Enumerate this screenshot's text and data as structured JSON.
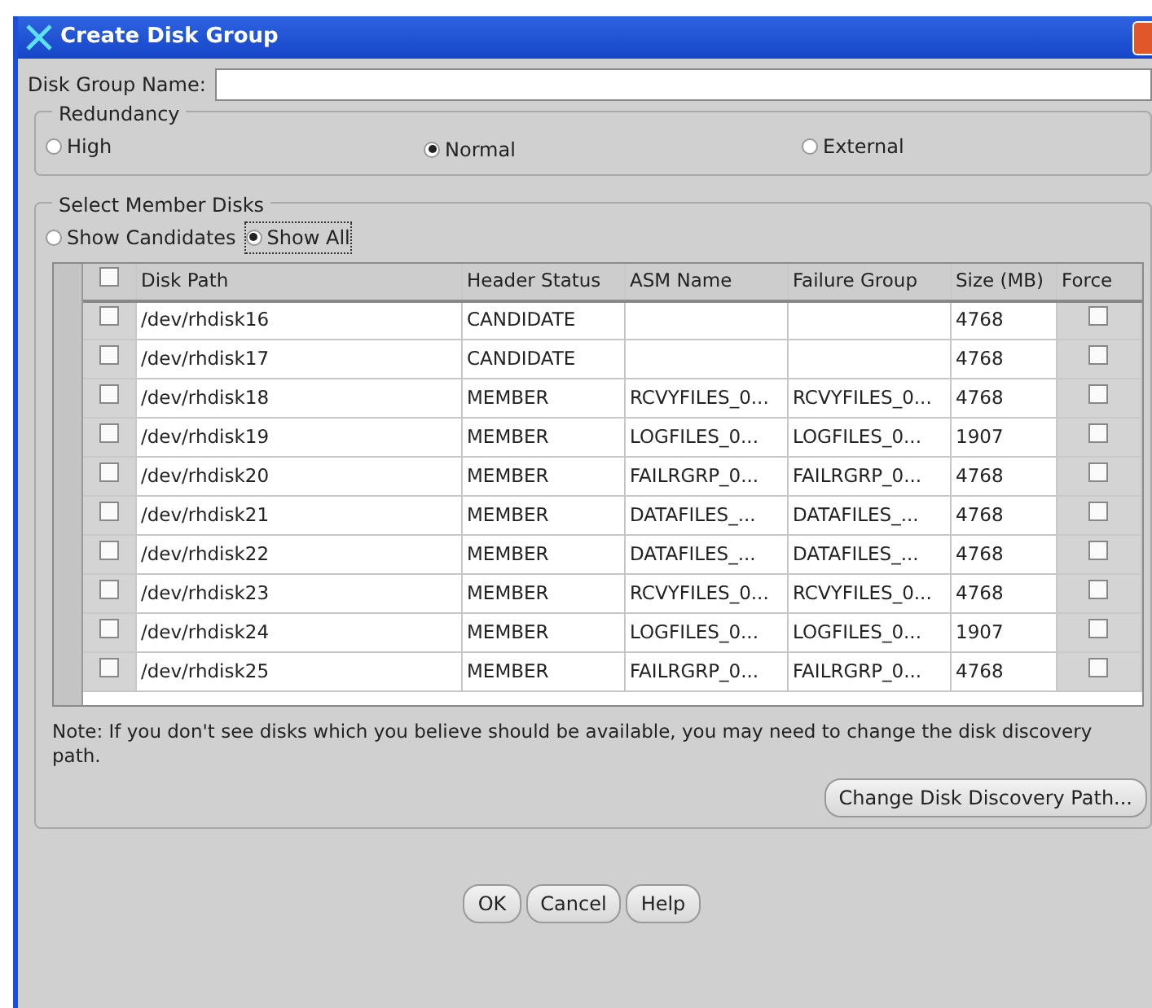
{
  "window": {
    "title": "Create Disk Group"
  },
  "disk_group_name": {
    "label": "Disk Group Name:"
  },
  "redundancy": {
    "legend": "Redundancy",
    "options": [
      {
        "label": "High",
        "selected": false
      },
      {
        "label": "Normal",
        "selected": true
      },
      {
        "label": "External",
        "selected": false
      }
    ]
  },
  "member_disks": {
    "legend": "Select Member Disks",
    "filter_options": [
      {
        "label": "Show Candidates",
        "selected": false
      },
      {
        "label": "Show All",
        "selected": true
      }
    ],
    "table": {
      "select_all_checked": false,
      "columns": [
        "Disk Path",
        "Header Status",
        "ASM Name",
        "Failure Group",
        "Size (MB)",
        "Force"
      ],
      "rows": [
        {
          "checked": false,
          "disk_path": "/dev/rhdisk16",
          "header_status": "CANDIDATE",
          "size_mb": "4768",
          "force": false
        },
        {
          "checked": false,
          "disk_path": "/dev/rhdisk17",
          "header_status": "CANDIDATE",
          "size_mb": "4768",
          "force": false
        },
        {
          "checked": false,
          "disk_path": "/dev/rhdisk18",
          "header_status": "MEMBER",
          "asm_name": "RCVYFILES_0...",
          "failure_group": "RCVYFILES_0...",
          "size_mb": "4768",
          "force": false
        },
        {
          "checked": false,
          "disk_path": "/dev/rhdisk19",
          "header_status": "MEMBER",
          "asm_name": "LOGFILES_0...",
          "failure_group": "LOGFILES_0...",
          "size_mb": "1907",
          "force": false
        },
        {
          "checked": false,
          "disk_path": "/dev/rhdisk20",
          "header_status": "MEMBER",
          "asm_name": "FAILRGRP_0...",
          "failure_group": "FAILRGRP_0...",
          "size_mb": "4768",
          "force": false
        },
        {
          "checked": false,
          "disk_path": "/dev/rhdisk21",
          "header_status": "MEMBER",
          "asm_name": "DATAFILES_...",
          "failure_group": "DATAFILES_...",
          "size_mb": "4768",
          "force": false
        },
        {
          "checked": false,
          "disk_path": "/dev/rhdisk22",
          "header_status": "MEMBER",
          "asm_name": "DATAFILES_...",
          "failure_group": "DATAFILES_...",
          "size_mb": "4768",
          "force": false
        },
        {
          "checked": false,
          "disk_path": "/dev/rhdisk23",
          "header_status": "MEMBER",
          "asm_name": "RCVYFILES_0...",
          "failure_group": "RCVYFILES_0...",
          "size_mb": "4768",
          "force": false
        },
        {
          "checked": false,
          "disk_path": "/dev/rhdisk24",
          "header_status": "MEMBER",
          "asm_name": "LOGFILES_0...",
          "failure_group": "LOGFILES_0...",
          "size_mb": "1907",
          "force": false
        },
        {
          "checked": false,
          "disk_path": "/dev/rhdisk25",
          "header_status": "MEMBER",
          "asm_name": "FAILRGRP_0...",
          "failure_group": "FAILRGRP_0...",
          "size_mb": "4768",
          "force": false
        }
      ]
    },
    "note": "Note: If you don't see disks which you believe should be available, you may need to change the disk discovery path.",
    "change_path_button": "Change Disk Discovery Path..."
  },
  "buttons": [
    "OK",
    "Cancel",
    "Help"
  ]
}
